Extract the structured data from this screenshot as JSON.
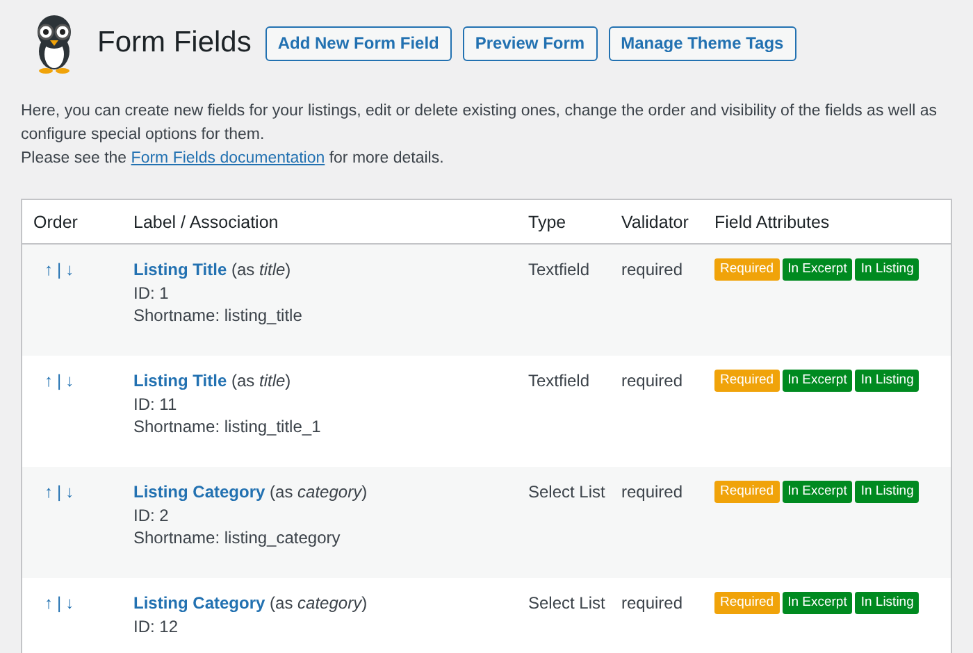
{
  "header": {
    "title": "Form Fields",
    "buttons": [
      "Add New Form Field",
      "Preview Form",
      "Manage Theme Tags"
    ]
  },
  "intro": {
    "text": "Here, you can create new fields for your listings, edit or delete existing ones, change the order and visibility of the fields as well as configure special options for them.",
    "see_before": "Please see the",
    "link": "Form Fields documentation",
    "see_after": "for more details."
  },
  "table": {
    "columns": [
      "Order",
      "Label / Association",
      "Type",
      "Validator",
      "Field Attributes"
    ],
    "rows": [
      {
        "up": "↑",
        "separator": "|",
        "down": "↓",
        "label": "Listing Title",
        "association": "(as *title*)",
        "id": "ID: 1",
        "shortname": "Shortname: listing_title",
        "type": "Textfield",
        "validator": "required",
        "attributes": [
          {
            "text": "Required",
            "color": "#f0a30a"
          },
          {
            "text": "In Excerpt",
            "color": "#008a20"
          },
          {
            "text": "In Listing",
            "color": "#008a20"
          }
        ]
      },
      {
        "up": "↑",
        "separator": "|",
        "down": "↓",
        "label": "Listing Title",
        "association": "(as *title*)",
        "id": "ID: 11",
        "shortname": "Shortname: listing_title_1",
        "type": "Textfield",
        "validator": "required",
        "attributes": [
          {
            "text": "Required",
            "color": "#f0a30a"
          },
          {
            "text": "In Excerpt",
            "color": "#008a20"
          },
          {
            "text": "In Listing",
            "color": "#008a20"
          }
        ]
      },
      {
        "up": "↑",
        "separator": "|",
        "down": "↓",
        "label": "Listing Category",
        "association": "(as *category*)",
        "id": "ID: 2",
        "shortname": "Shortname: listing_category",
        "type": "Select List",
        "validator": "required",
        "attributes": [
          {
            "text": "Required",
            "color": "#f0a30a"
          },
          {
            "text": "In Excerpt",
            "color": "#008a20"
          },
          {
            "text": "In Listing",
            "color": "#008a20"
          }
        ]
      },
      {
        "up": "↑",
        "separator": "|",
        "down": "↓",
        "label": "Listing Category",
        "association": "(as *category*)",
        "id": "ID: 12",
        "type": "Select List",
        "validator": "required",
        "attributes": [
          {
            "text": "Required",
            "color": "#f0a30a"
          },
          {
            "text": "In Excerpt",
            "color": "#008a20"
          },
          {
            "text": "In Listing",
            "color": "#008a20"
          }
        ]
      }
    ]
  }
}
